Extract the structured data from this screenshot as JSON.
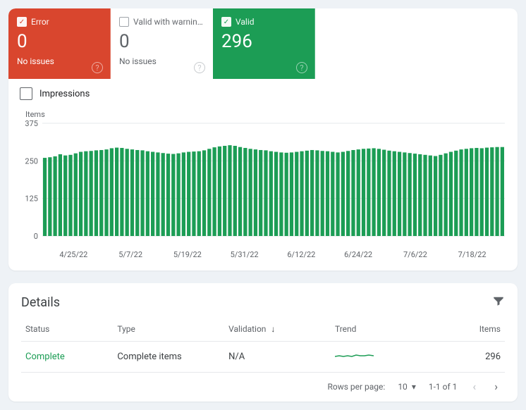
{
  "tabs": {
    "error": {
      "label": "Error",
      "count": "0",
      "issues": "No issues"
    },
    "warn": {
      "label": "Valid with warnin…",
      "count": "0",
      "issues": "No issues"
    },
    "valid": {
      "label": "Valid",
      "count": "296",
      "issues": ""
    }
  },
  "impressions_label": "Impressions",
  "yaxis_title": "Items",
  "details": {
    "title": "Details",
    "columns": {
      "status": "Status",
      "type": "Type",
      "validation": "Validation",
      "trend": "Trend",
      "items": "Items"
    },
    "rows": [
      {
        "status": "Complete",
        "type": "Complete items",
        "validation": "N/A",
        "items": "296"
      }
    ],
    "pager": {
      "rows_label": "Rows per page:",
      "rows_value": "10",
      "range": "1-1 of 1"
    }
  },
  "chart_data": {
    "type": "bar",
    "title": "",
    "xlabel": "",
    "ylabel": "Items",
    "ylim": [
      0,
      375
    ],
    "yticks": [
      0,
      125,
      250,
      375
    ],
    "x_tick_labels": [
      "4/25/22",
      "5/7/22",
      "5/19/22",
      "5/31/22",
      "6/12/22",
      "6/24/22",
      "7/6/22",
      "7/18/22"
    ],
    "categories": [
      "4/25/22",
      "4/26/22",
      "4/27/22",
      "4/28/22",
      "4/29/22",
      "4/30/22",
      "5/1/22",
      "5/2/22",
      "5/3/22",
      "5/4/22",
      "5/5/22",
      "5/6/22",
      "5/7/22",
      "5/8/22",
      "5/9/22",
      "5/10/22",
      "5/11/22",
      "5/12/22",
      "5/13/22",
      "5/14/22",
      "5/15/22",
      "5/16/22",
      "5/17/22",
      "5/18/22",
      "5/19/22",
      "5/20/22",
      "5/21/22",
      "5/22/22",
      "5/23/22",
      "5/24/22",
      "5/25/22",
      "5/26/22",
      "5/27/22",
      "5/28/22",
      "5/29/22",
      "5/30/22",
      "5/31/22",
      "6/1/22",
      "6/2/22",
      "6/3/22",
      "6/4/22",
      "6/5/22",
      "6/6/22",
      "6/7/22",
      "6/8/22",
      "6/9/22",
      "6/10/22",
      "6/11/22",
      "6/12/22",
      "6/13/22",
      "6/14/22",
      "6/15/22",
      "6/16/22",
      "6/17/22",
      "6/18/22",
      "6/19/22",
      "6/20/22",
      "6/21/22",
      "6/22/22",
      "6/23/22",
      "6/24/22",
      "6/25/22",
      "6/26/22",
      "6/27/22",
      "6/28/22",
      "6/29/22",
      "6/30/22",
      "7/1/22",
      "7/2/22",
      "7/3/22",
      "7/4/22",
      "7/5/22",
      "7/6/22",
      "7/7/22",
      "7/8/22",
      "7/9/22",
      "7/10/22",
      "7/11/22",
      "7/12/22",
      "7/13/22",
      "7/14/22",
      "7/15/22",
      "7/16/22",
      "7/17/22",
      "7/18/22",
      "7/19/22",
      "7/20/22",
      "7/21/22",
      "7/22/22",
      "7/23/22"
    ],
    "values": [
      260,
      262,
      265,
      272,
      268,
      270,
      275,
      280,
      282,
      283,
      285,
      286,
      288,
      292,
      294,
      293,
      290,
      288,
      286,
      285,
      282,
      280,
      278,
      276,
      274,
      273,
      275,
      278,
      280,
      281,
      282,
      285,
      290,
      295,
      298,
      300,
      302,
      300,
      296,
      293,
      290,
      288,
      286,
      285,
      282,
      280,
      278,
      277,
      278,
      280,
      282,
      284,
      286,
      285,
      283,
      282,
      280,
      278,
      280,
      283,
      286,
      288,
      290,
      291,
      292,
      290,
      287,
      284,
      282,
      280,
      278,
      276,
      274,
      272,
      270,
      268,
      266,
      270,
      275,
      280,
      284,
      288,
      290,
      292,
      293,
      292,
      294,
      295,
      296,
      296
    ]
  }
}
